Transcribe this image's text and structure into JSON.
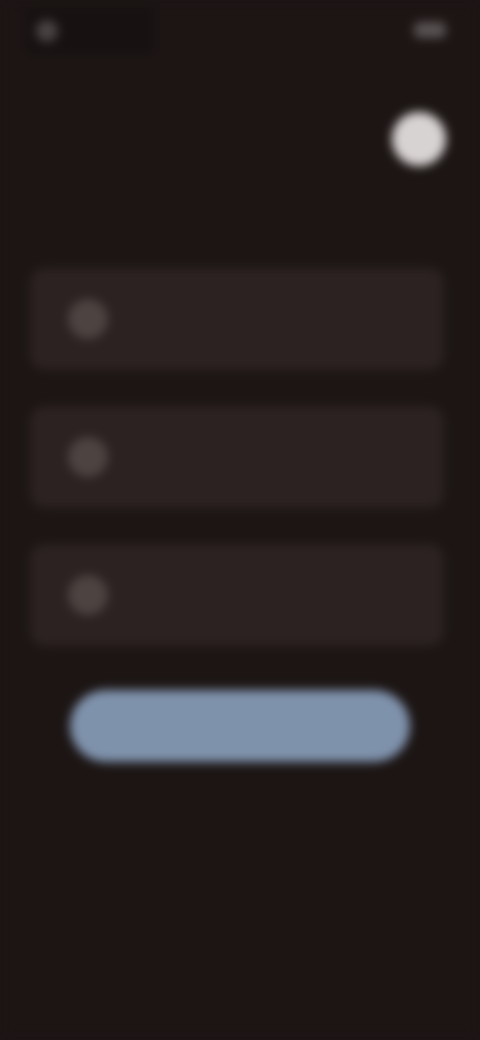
{
  "status_bar": {
    "time": "",
    "system": "",
    "icons": [
      "app-icon",
      "battery-icon"
    ]
  },
  "header": {
    "title": "",
    "avatar_icon": "profile-avatar"
  },
  "options": [
    {
      "icon": "option-icon",
      "title": "",
      "subtitle": ""
    },
    {
      "icon": "option-icon",
      "title": "",
      "subtitle": ""
    },
    {
      "icon": "option-icon",
      "title": "",
      "subtitle": ""
    }
  ],
  "primary_button": {
    "label": ""
  },
  "colors": {
    "background": "#1c1514",
    "card": "#2b2221",
    "accent": "#7f92ac",
    "avatar": "#d8d3d3"
  }
}
